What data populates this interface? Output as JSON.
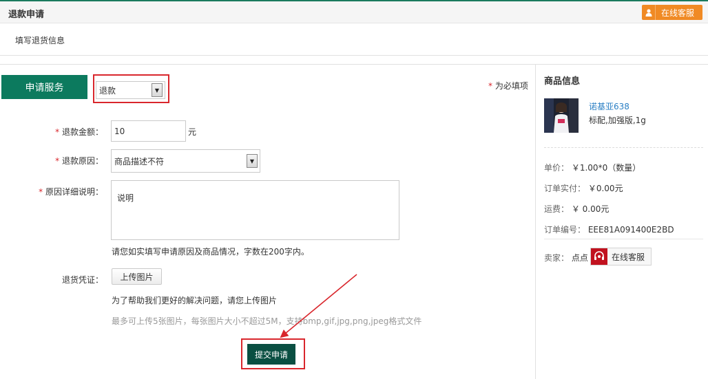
{
  "header": {
    "title": "退款申请",
    "cs_label": "在线客服",
    "cs_icon": "person-icon"
  },
  "subheader": {
    "text": "填写退货信息"
  },
  "form": {
    "service_tab": "申请服务",
    "service_type": "退款",
    "required_star": "*",
    "required_note": "为必填项",
    "amount_label": "退款金额：",
    "amount_value": "10",
    "amount_unit": "元",
    "reason_label": "退款原因：",
    "reason_value": "商品描述不符",
    "detail_label": "原因详细说明：",
    "detail_value": "说明",
    "detail_hint": "请您如实填写申请原因及商品情况，字数在200字内。",
    "proof_label": "退货凭证：",
    "upload_label": "上传图片",
    "upload_hint": "为了帮助我们更好的解决问题，请您上传图片",
    "upload_limit": "最多可上传5张图片，每张图片大小不超过5M，支持bmp,gif,jpg,png,jpeg格式文件",
    "submit_label": "提交申请"
  },
  "product": {
    "title": "商品信息",
    "name": "诺基亚638",
    "spec": "标配,加强版,1g",
    "unit_price_label": "单价：",
    "unit_price_value": "￥1.00*0（数量）",
    "paid_label": "订单实付：",
    "paid_value": "￥0.00元",
    "shipping_label": "运费：",
    "shipping_value": "￥ 0.00元",
    "order_no_label": "订单编号：",
    "order_no_value": "EEE81A091400E2BD",
    "seller_label": "卖家：",
    "seller_value": "点点",
    "cs_label": "在线客服",
    "cs_icon": "headset-icon"
  },
  "colors": {
    "brand_green": "#0c7a5e",
    "submit_dark": "#0a4f42",
    "cs_orange": "#f08a24",
    "highlight_red": "#d9262c",
    "link_blue": "#2a7fc4"
  }
}
